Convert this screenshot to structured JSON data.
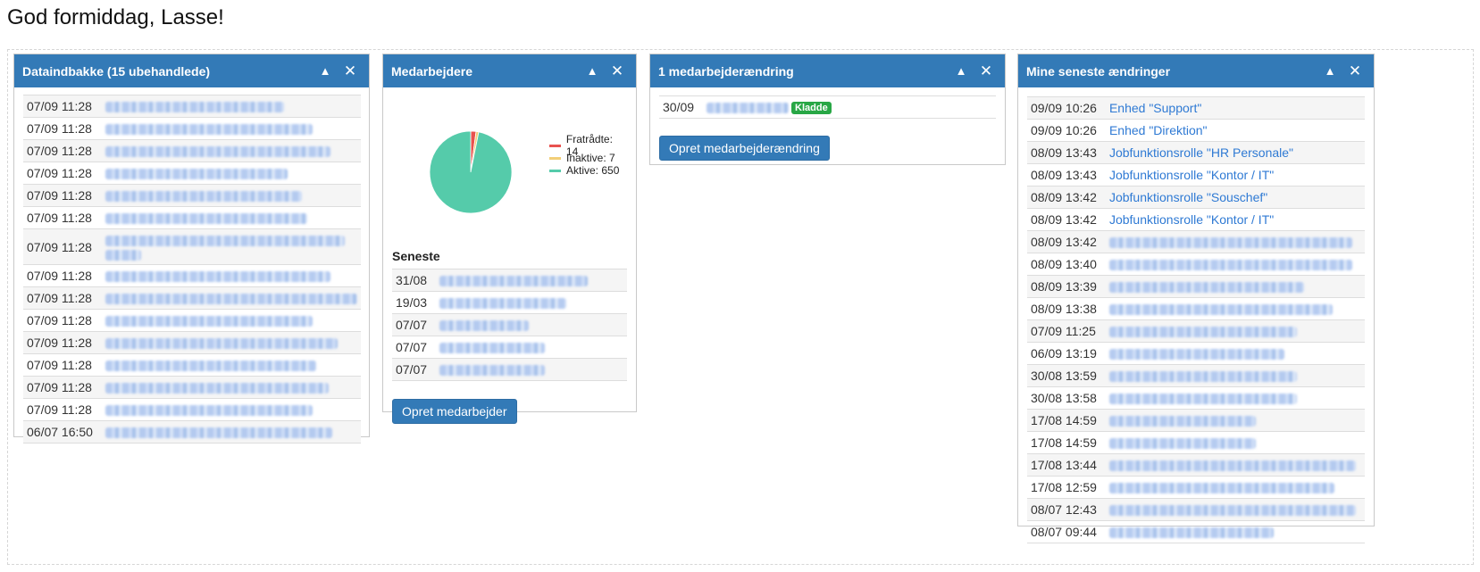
{
  "greeting": "God formiddag, Lasse!",
  "colors": {
    "header": "#337ab7",
    "link": "#2f7ad4",
    "badge": "#28a745"
  },
  "icons": {
    "collapse": "triangle-up-icon",
    "close": "close-icon"
  },
  "inbox": {
    "title": "Dataindbakke (15 ubehandlede)",
    "rows": [
      {
        "date": "07/09 11:28"
      },
      {
        "date": "07/09 11:28"
      },
      {
        "date": "07/09 11:28"
      },
      {
        "date": "07/09 11:28"
      },
      {
        "date": "07/09 11:28"
      },
      {
        "date": "07/09 11:28"
      },
      {
        "date": "07/09 11:28"
      },
      {
        "date": "07/09 11:28"
      },
      {
        "date": "07/09 11:28"
      },
      {
        "date": "07/09 11:28"
      },
      {
        "date": "07/09 11:28"
      },
      {
        "date": "07/09 11:28"
      },
      {
        "date": "07/09 11:28"
      },
      {
        "date": "07/09 11:28"
      },
      {
        "date": "06/07 16:50"
      }
    ]
  },
  "employees": {
    "title": "Medarbejdere",
    "chart_data": {
      "type": "pie",
      "categories": [
        "Fratrådte",
        "Inaktive",
        "Aktive"
      ],
      "values": [
        14,
        7,
        650
      ],
      "legend": [
        "Fratrådte: 14",
        "Inaktive: 7",
        "Aktive: 650"
      ],
      "colors": [
        "#e8524f",
        "#f2cf78",
        "#55cbaa"
      ],
      "legend_position": "right"
    },
    "recent_heading": "Seneste",
    "recent": [
      {
        "date": "31/08"
      },
      {
        "date": "19/03"
      },
      {
        "date": "07/07"
      },
      {
        "date": "07/07"
      },
      {
        "date": "07/07"
      }
    ],
    "create_label": "Opret medarbejder"
  },
  "changes": {
    "title": "1 medarbejderændring",
    "rows": [
      {
        "date": "30/09",
        "badge": "Kladde"
      }
    ],
    "create_label": "Opret medarbejderændring"
  },
  "mine": {
    "title": "Mine seneste ændringer",
    "rows": [
      {
        "date": "09/09 10:26",
        "text": "Enhed \"Support\""
      },
      {
        "date": "09/09 10:26",
        "text": "Enhed \"Direktion\""
      },
      {
        "date": "08/09 13:43",
        "text": "Jobfunktionsrolle \"HR Personale\""
      },
      {
        "date": "08/09 13:43",
        "text": "Jobfunktionsrolle \"Kontor / IT\""
      },
      {
        "date": "08/09 13:42",
        "text": "Jobfunktionsrolle \"Souschef\""
      },
      {
        "date": "08/09 13:42",
        "text": "Jobfunktionsrolle \"Kontor / IT\""
      },
      {
        "date": "08/09 13:42"
      },
      {
        "date": "08/09 13:40"
      },
      {
        "date": "08/09 13:39"
      },
      {
        "date": "08/09 13:38"
      },
      {
        "date": "07/09 11:25"
      },
      {
        "date": "06/09 13:19"
      },
      {
        "date": "30/08 13:59"
      },
      {
        "date": "30/08 13:58"
      },
      {
        "date": "17/08 14:59"
      },
      {
        "date": "17/08 14:59"
      },
      {
        "date": "17/08 13:44"
      },
      {
        "date": "17/08 12:59"
      },
      {
        "date": "08/07 12:43"
      },
      {
        "date": "08/07 09:44"
      }
    ]
  }
}
